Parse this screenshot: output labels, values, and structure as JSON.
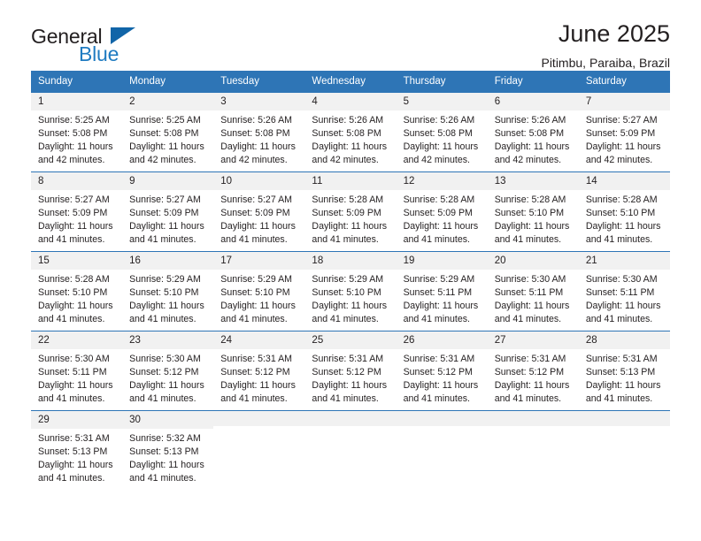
{
  "brand": {
    "name_top": "General",
    "name_bottom": "Blue",
    "triangle_icon": "triangle-icon",
    "color_primary": "#1165a8",
    "color_secondary": "#1f7bc1"
  },
  "header": {
    "title": "June 2025",
    "subtitle": "Pitimbu, Paraiba, Brazil"
  },
  "calendar": {
    "header_bg": "#2e75b6",
    "daynum_bg": "#f1f1f1",
    "weekday_labels": [
      "Sunday",
      "Monday",
      "Tuesday",
      "Wednesday",
      "Thursday",
      "Friday",
      "Saturday"
    ],
    "weeks": [
      [
        {
          "day": "1",
          "sunrise": "Sunrise: 5:25 AM",
          "sunset": "Sunset: 5:08 PM",
          "daylight_line1": "Daylight: 11 hours",
          "daylight_line2": "and 42 minutes."
        },
        {
          "day": "2",
          "sunrise": "Sunrise: 5:25 AM",
          "sunset": "Sunset: 5:08 PM",
          "daylight_line1": "Daylight: 11 hours",
          "daylight_line2": "and 42 minutes."
        },
        {
          "day": "3",
          "sunrise": "Sunrise: 5:26 AM",
          "sunset": "Sunset: 5:08 PM",
          "daylight_line1": "Daylight: 11 hours",
          "daylight_line2": "and 42 minutes."
        },
        {
          "day": "4",
          "sunrise": "Sunrise: 5:26 AM",
          "sunset": "Sunset: 5:08 PM",
          "daylight_line1": "Daylight: 11 hours",
          "daylight_line2": "and 42 minutes."
        },
        {
          "day": "5",
          "sunrise": "Sunrise: 5:26 AM",
          "sunset": "Sunset: 5:08 PM",
          "daylight_line1": "Daylight: 11 hours",
          "daylight_line2": "and 42 minutes."
        },
        {
          "day": "6",
          "sunrise": "Sunrise: 5:26 AM",
          "sunset": "Sunset: 5:08 PM",
          "daylight_line1": "Daylight: 11 hours",
          "daylight_line2": "and 42 minutes."
        },
        {
          "day": "7",
          "sunrise": "Sunrise: 5:27 AM",
          "sunset": "Sunset: 5:09 PM",
          "daylight_line1": "Daylight: 11 hours",
          "daylight_line2": "and 42 minutes."
        }
      ],
      [
        {
          "day": "8",
          "sunrise": "Sunrise: 5:27 AM",
          "sunset": "Sunset: 5:09 PM",
          "daylight_line1": "Daylight: 11 hours",
          "daylight_line2": "and 41 minutes."
        },
        {
          "day": "9",
          "sunrise": "Sunrise: 5:27 AM",
          "sunset": "Sunset: 5:09 PM",
          "daylight_line1": "Daylight: 11 hours",
          "daylight_line2": "and 41 minutes."
        },
        {
          "day": "10",
          "sunrise": "Sunrise: 5:27 AM",
          "sunset": "Sunset: 5:09 PM",
          "daylight_line1": "Daylight: 11 hours",
          "daylight_line2": "and 41 minutes."
        },
        {
          "day": "11",
          "sunrise": "Sunrise: 5:28 AM",
          "sunset": "Sunset: 5:09 PM",
          "daylight_line1": "Daylight: 11 hours",
          "daylight_line2": "and 41 minutes."
        },
        {
          "day": "12",
          "sunrise": "Sunrise: 5:28 AM",
          "sunset": "Sunset: 5:09 PM",
          "daylight_line1": "Daylight: 11 hours",
          "daylight_line2": "and 41 minutes."
        },
        {
          "day": "13",
          "sunrise": "Sunrise: 5:28 AM",
          "sunset": "Sunset: 5:10 PM",
          "daylight_line1": "Daylight: 11 hours",
          "daylight_line2": "and 41 minutes."
        },
        {
          "day": "14",
          "sunrise": "Sunrise: 5:28 AM",
          "sunset": "Sunset: 5:10 PM",
          "daylight_line1": "Daylight: 11 hours",
          "daylight_line2": "and 41 minutes."
        }
      ],
      [
        {
          "day": "15",
          "sunrise": "Sunrise: 5:28 AM",
          "sunset": "Sunset: 5:10 PM",
          "daylight_line1": "Daylight: 11 hours",
          "daylight_line2": "and 41 minutes."
        },
        {
          "day": "16",
          "sunrise": "Sunrise: 5:29 AM",
          "sunset": "Sunset: 5:10 PM",
          "daylight_line1": "Daylight: 11 hours",
          "daylight_line2": "and 41 minutes."
        },
        {
          "day": "17",
          "sunrise": "Sunrise: 5:29 AM",
          "sunset": "Sunset: 5:10 PM",
          "daylight_line1": "Daylight: 11 hours",
          "daylight_line2": "and 41 minutes."
        },
        {
          "day": "18",
          "sunrise": "Sunrise: 5:29 AM",
          "sunset": "Sunset: 5:10 PM",
          "daylight_line1": "Daylight: 11 hours",
          "daylight_line2": "and 41 minutes."
        },
        {
          "day": "19",
          "sunrise": "Sunrise: 5:29 AM",
          "sunset": "Sunset: 5:11 PM",
          "daylight_line1": "Daylight: 11 hours",
          "daylight_line2": "and 41 minutes."
        },
        {
          "day": "20",
          "sunrise": "Sunrise: 5:30 AM",
          "sunset": "Sunset: 5:11 PM",
          "daylight_line1": "Daylight: 11 hours",
          "daylight_line2": "and 41 minutes."
        },
        {
          "day": "21",
          "sunrise": "Sunrise: 5:30 AM",
          "sunset": "Sunset: 5:11 PM",
          "daylight_line1": "Daylight: 11 hours",
          "daylight_line2": "and 41 minutes."
        }
      ],
      [
        {
          "day": "22",
          "sunrise": "Sunrise: 5:30 AM",
          "sunset": "Sunset: 5:11 PM",
          "daylight_line1": "Daylight: 11 hours",
          "daylight_line2": "and 41 minutes."
        },
        {
          "day": "23",
          "sunrise": "Sunrise: 5:30 AM",
          "sunset": "Sunset: 5:12 PM",
          "daylight_line1": "Daylight: 11 hours",
          "daylight_line2": "and 41 minutes."
        },
        {
          "day": "24",
          "sunrise": "Sunrise: 5:31 AM",
          "sunset": "Sunset: 5:12 PM",
          "daylight_line1": "Daylight: 11 hours",
          "daylight_line2": "and 41 minutes."
        },
        {
          "day": "25",
          "sunrise": "Sunrise: 5:31 AM",
          "sunset": "Sunset: 5:12 PM",
          "daylight_line1": "Daylight: 11 hours",
          "daylight_line2": "and 41 minutes."
        },
        {
          "day": "26",
          "sunrise": "Sunrise: 5:31 AM",
          "sunset": "Sunset: 5:12 PM",
          "daylight_line1": "Daylight: 11 hours",
          "daylight_line2": "and 41 minutes."
        },
        {
          "day": "27",
          "sunrise": "Sunrise: 5:31 AM",
          "sunset": "Sunset: 5:12 PM",
          "daylight_line1": "Daylight: 11 hours",
          "daylight_line2": "and 41 minutes."
        },
        {
          "day": "28",
          "sunrise": "Sunrise: 5:31 AM",
          "sunset": "Sunset: 5:13 PM",
          "daylight_line1": "Daylight: 11 hours",
          "daylight_line2": "and 41 minutes."
        }
      ],
      [
        {
          "day": "29",
          "sunrise": "Sunrise: 5:31 AM",
          "sunset": "Sunset: 5:13 PM",
          "daylight_line1": "Daylight: 11 hours",
          "daylight_line2": "and 41 minutes."
        },
        {
          "day": "30",
          "sunrise": "Sunrise: 5:32 AM",
          "sunset": "Sunset: 5:13 PM",
          "daylight_line1": "Daylight: 11 hours",
          "daylight_line2": "and 41 minutes."
        },
        {
          "day": "",
          "sunrise": "",
          "sunset": "",
          "daylight_line1": "",
          "daylight_line2": ""
        },
        {
          "day": "",
          "sunrise": "",
          "sunset": "",
          "daylight_line1": "",
          "daylight_line2": ""
        },
        {
          "day": "",
          "sunrise": "",
          "sunset": "",
          "daylight_line1": "",
          "daylight_line2": ""
        },
        {
          "day": "",
          "sunrise": "",
          "sunset": "",
          "daylight_line1": "",
          "daylight_line2": ""
        },
        {
          "day": "",
          "sunrise": "",
          "sunset": "",
          "daylight_line1": "",
          "daylight_line2": ""
        }
      ]
    ]
  }
}
